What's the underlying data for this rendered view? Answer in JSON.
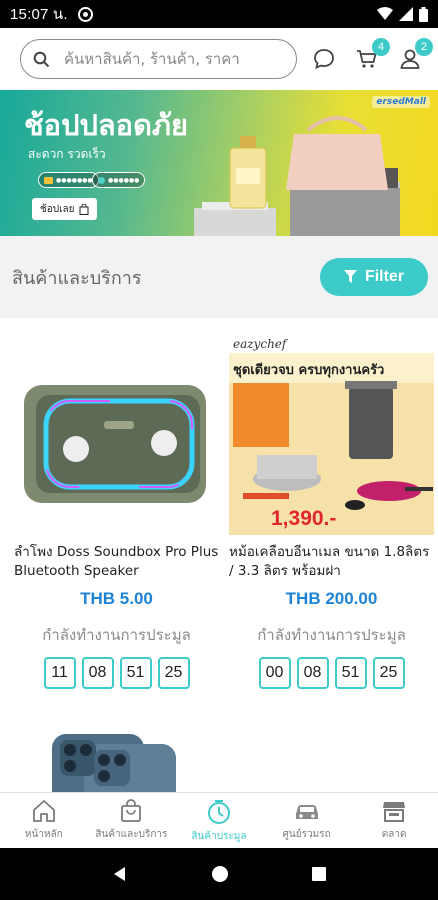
{
  "status_bar": {
    "time": "15:07 น."
  },
  "header": {
    "search_placeholder": "ค้นหาสินค้า, ร้านค้า, ราคา",
    "cart_badge": "4",
    "account_badge": "2"
  },
  "banner": {
    "title": "ช้อปปลอดภัย",
    "subtitle": "สะดวก รวดเร็ว",
    "button_label": "ช้อปเลย",
    "brand": "ersedMall"
  },
  "section": {
    "title": "สินค้าและบริการ",
    "filter_label": "Filter"
  },
  "products": [
    {
      "name": "ลำโพง Doss Soundbox Pro Plus Bluetooth Speaker",
      "price": "THB 5.00",
      "status": "กำลังทำงานการประมูล",
      "countdown": [
        "11",
        "08",
        "51",
        "25"
      ]
    },
    {
      "name": "หม้อเคลือบอีนาเมล ขนาด 1.8ลิตร / 3.3 ลิตร พร้อมฝา",
      "price": "THB 200.00",
      "status": "กำลังทำงานการประมูล",
      "countdown": [
        "00",
        "08",
        "51",
        "25"
      ],
      "image_brand": "eazychef",
      "image_headline": "ชุดเดียวจบ ครบทุกงานครัว",
      "image_price": "1,390.-"
    }
  ],
  "bottom_nav": [
    {
      "label": "หน้าหลัก",
      "icon": "home-icon",
      "active": false
    },
    {
      "label": "สินค้าและบริการ",
      "icon": "shopping-bag-icon",
      "active": false
    },
    {
      "label": "สินค้าประมูล",
      "icon": "timer-icon",
      "active": true
    },
    {
      "label": "ศูนย์รวมรถ",
      "icon": "car-icon",
      "active": false
    },
    {
      "label": "ตลาด",
      "icon": "store-icon",
      "active": false
    }
  ],
  "colors": {
    "accent": "#3ccbc8",
    "price": "#1e83d6"
  }
}
